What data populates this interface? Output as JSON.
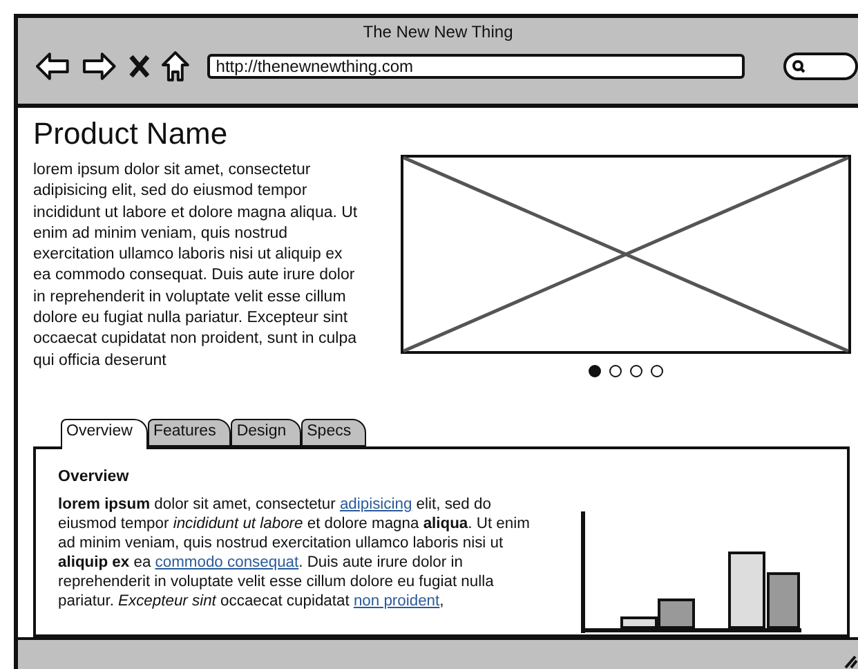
{
  "window": {
    "title": "The New New Thing"
  },
  "toolbar": {
    "url": "http://thenewnewthing.com"
  },
  "product": {
    "title": "Product Name",
    "description": "lorem ipsum dolor sit amet, consectetur adipisicing elit, sed do eiusmod tempor incididunt ut labore et dolore magna aliqua. Ut enim ad minim veniam, quis nostrud exercitation ullamco laboris nisi ut aliquip ex ea commodo consequat. Duis aute irure dolor in reprehenderit in voluptate velit esse cillum dolore eu fugiat nulla pariatur. Excepteur sint occaecat cupidatat non proident, sunt in culpa qui officia deserunt"
  },
  "carousel": [
    {
      "selected": true
    },
    {
      "selected": false
    },
    {
      "selected": false
    },
    {
      "selected": false
    }
  ],
  "tabs": [
    {
      "label": "Overview",
      "selected": true
    },
    {
      "label": "Features",
      "selected": false
    },
    {
      "label": "Design",
      "selected": false
    },
    {
      "label": "Specs",
      "selected": false
    }
  ],
  "panel": {
    "heading": "Overview",
    "body": [
      {
        "kind": "bold",
        "text": "lorem ipsum"
      },
      {
        "kind": "plain",
        "text": " dolor sit amet, consectetur "
      },
      {
        "kind": "link",
        "text": "adipisicing"
      },
      {
        "kind": "plain",
        "text": " elit, sed do eiusmod tempor "
      },
      {
        "kind": "italic",
        "text": "incididunt ut labore"
      },
      {
        "kind": "plain",
        "text": " et dolore magna "
      },
      {
        "kind": "bold",
        "text": "aliqua"
      },
      {
        "kind": "plain",
        "text": ". Ut enim ad minim veniam, quis nostrud exercitation ullamco laboris nisi ut "
      },
      {
        "kind": "bold",
        "text": "aliquip ex"
      },
      {
        "kind": "plain",
        "text": " ea "
      },
      {
        "kind": "link",
        "text": "commodo consequat"
      },
      {
        "kind": "plain",
        "text": ". Duis aute irure dolor in reprehenderit in voluptate velit esse cillum dolore eu fugiat nulla pariatur. "
      },
      {
        "kind": "italic",
        "text": "Excepteur sint"
      },
      {
        "kind": "plain",
        "text": " occaecat cupidatat "
      },
      {
        "kind": "link",
        "text": "non proident"
      },
      {
        "kind": "plain",
        "text": ","
      }
    ]
  }
}
